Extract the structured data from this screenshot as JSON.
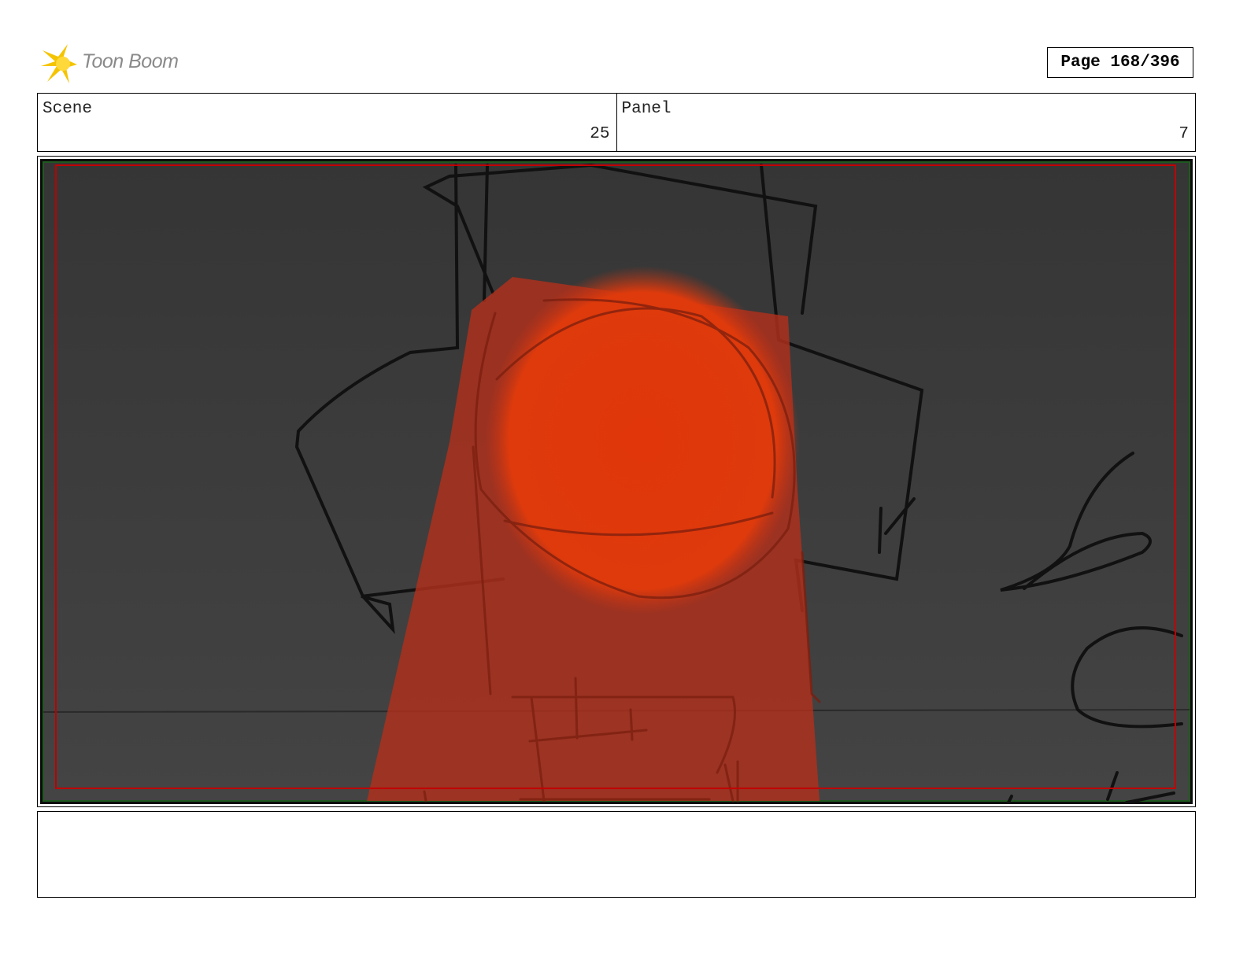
{
  "header": {
    "logo_text": "Toon Boom",
    "page_label": "Page 168/396"
  },
  "info": {
    "scene_label": "Scene",
    "scene_value": "25",
    "panel_label": "Panel",
    "panel_value": "7"
  },
  "colors": {
    "background": "#3a3a3a",
    "light_blob": "#e0360a",
    "light_beam": "#b0301c",
    "safe_frame": "#c00000",
    "sketch_line": "#111111",
    "logo_yellow": "#f5c400"
  },
  "notes": {
    "text": ""
  }
}
